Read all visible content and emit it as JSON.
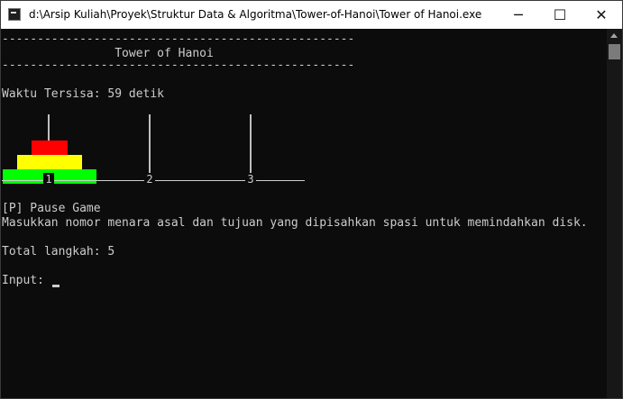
{
  "window": {
    "title": "d:\\Arsip Kuliah\\Proyek\\Struktur Data & Algoritma\\Tower-of-Hanoi\\Tower of Hanoi.exe",
    "icon": "console-app-icon",
    "controls": {
      "minimize": "─",
      "maximize": "☐",
      "close": "✕"
    }
  },
  "console": {
    "separator_top": "--------------------------------------------------",
    "header": "                Tower of Hanoi",
    "separator_bottom": "--------------------------------------------------",
    "timer": "Waktu Tersisa: 59 detik",
    "pause_hint": "[P] Pause Game",
    "instruction": "Masukkan nomor menara asal dan tujuan yang dipisahkan spasi untuk memindahkan disk.",
    "steps": "Total langkah: 5",
    "input_prompt": "Input: "
  },
  "towers": {
    "labels": [
      "1",
      "2",
      "3"
    ],
    "disks": [
      {
        "tower": 1,
        "size": 1,
        "color": "#ff0000"
      },
      {
        "tower": 1,
        "size": 2,
        "color": "#ffff00"
      },
      {
        "tower": 1,
        "size": 3,
        "color": "#00ff00"
      }
    ]
  },
  "colors": {
    "console_background": "#0c0c0c",
    "console_text": "#cccccc",
    "titlebar": "#ffffff"
  }
}
